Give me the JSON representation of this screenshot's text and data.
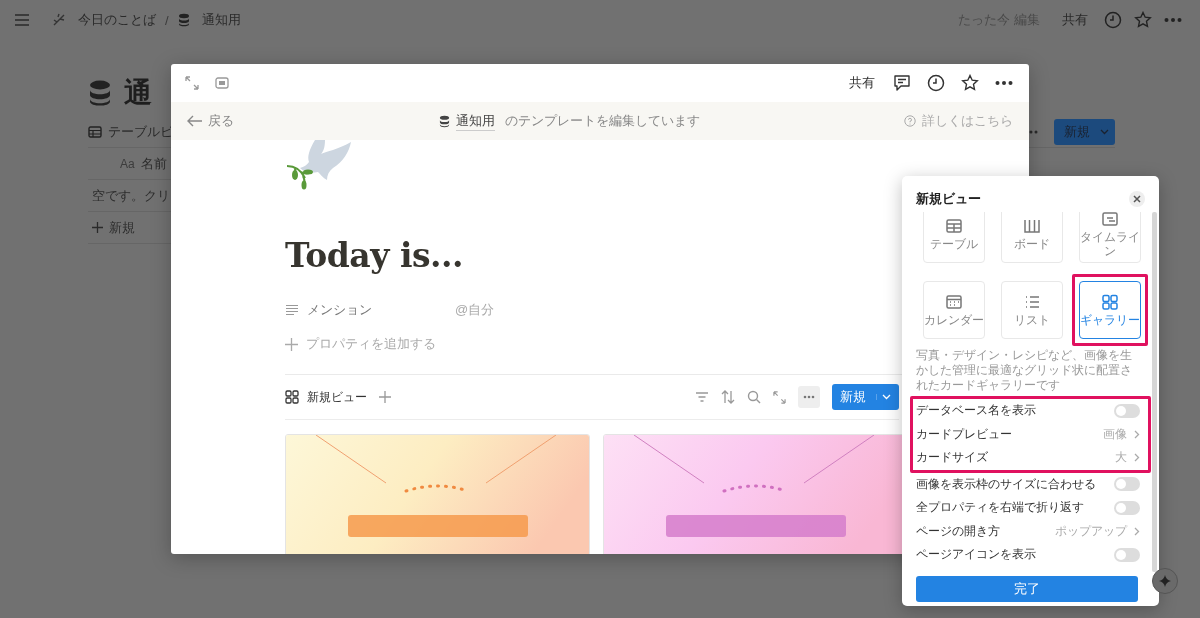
{
  "topbar": {
    "breadcrumb": [
      "今日のことば",
      "通知用"
    ],
    "separator": "/",
    "edited": "たった今 編集",
    "share": "共有"
  },
  "page": {
    "title": "通",
    "view_tab": "テーブルビ",
    "column_mark": "Aa",
    "column": "名前",
    "empty": "空です。クリ",
    "add_row": "新規",
    "new_button": "新規"
  },
  "modal": {
    "share": "共有",
    "back": "戻る",
    "template_db": "通知用",
    "template_text": "のテンプレートを編集しています",
    "help": "詳しくはこちら",
    "title": "Today is...",
    "properties": [
      {
        "label": "メンション",
        "value": "@自分"
      }
    ],
    "add_property": "プロパティを追加する",
    "view_tab": "新規ビュー",
    "new_button": "新規"
  },
  "view_panel": {
    "title": "新規ビュー",
    "view_types": [
      {
        "label": "テーブル",
        "selected": false
      },
      {
        "label": "ボード",
        "selected": false
      },
      {
        "label": "タイムライン",
        "selected": false
      },
      {
        "label": "カレンダー",
        "selected": false
      },
      {
        "label": "リスト",
        "selected": false
      },
      {
        "label": "ギャラリー",
        "selected": true,
        "highlighted": true
      }
    ],
    "description": "写真・デザイン・レシピなど、画像を生かした管理に最適なグリッド状に配置されたカードギャラリーです",
    "settings": [
      {
        "kind": "toggle",
        "label": "データベース名を表示",
        "on": false,
        "highlighted": true
      },
      {
        "kind": "select",
        "label": "カードプレビュー",
        "value": "画像",
        "highlighted": true
      },
      {
        "kind": "select",
        "label": "カードサイズ",
        "value": "大",
        "highlighted": true
      },
      {
        "kind": "toggle",
        "label": "画像を表示枠のサイズに合わせる",
        "on": false
      },
      {
        "kind": "toggle",
        "label": "全プロパティを右端で折り返す",
        "on": false
      },
      {
        "kind": "select",
        "label": "ページの開き方",
        "value": "ポップアップ"
      },
      {
        "kind": "toggle",
        "label": "ページアイコンを表示",
        "on": false
      }
    ],
    "done": "完了"
  }
}
